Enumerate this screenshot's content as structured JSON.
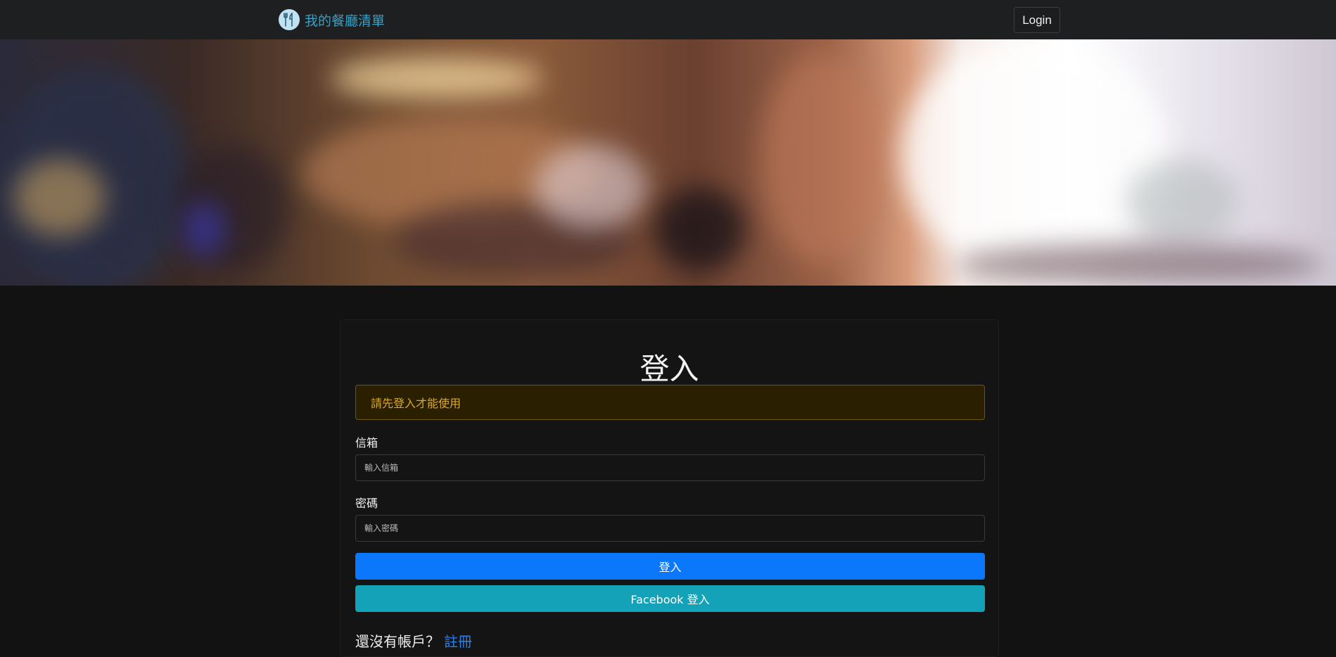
{
  "navbar": {
    "brand_text": "我的餐廳清單",
    "login_label": "Login"
  },
  "login": {
    "title": "登入",
    "alert": "請先登入才能使用",
    "email_label": "信箱",
    "email_placeholder": "輸入信箱",
    "password_label": "密碼",
    "password_placeholder": "輸入密碼",
    "submit_label": "登入",
    "facebook_label": "Facebook 登入",
    "signup_prompt": "還沒有帳戶？",
    "signup_link": "註冊"
  },
  "colors": {
    "accent": "#0b78fb",
    "facebook_button": "#13a2b8",
    "brand": "#3d9fc2",
    "alert_text": "#d9a830"
  },
  "icons": {
    "brand": "utensils-icon"
  }
}
